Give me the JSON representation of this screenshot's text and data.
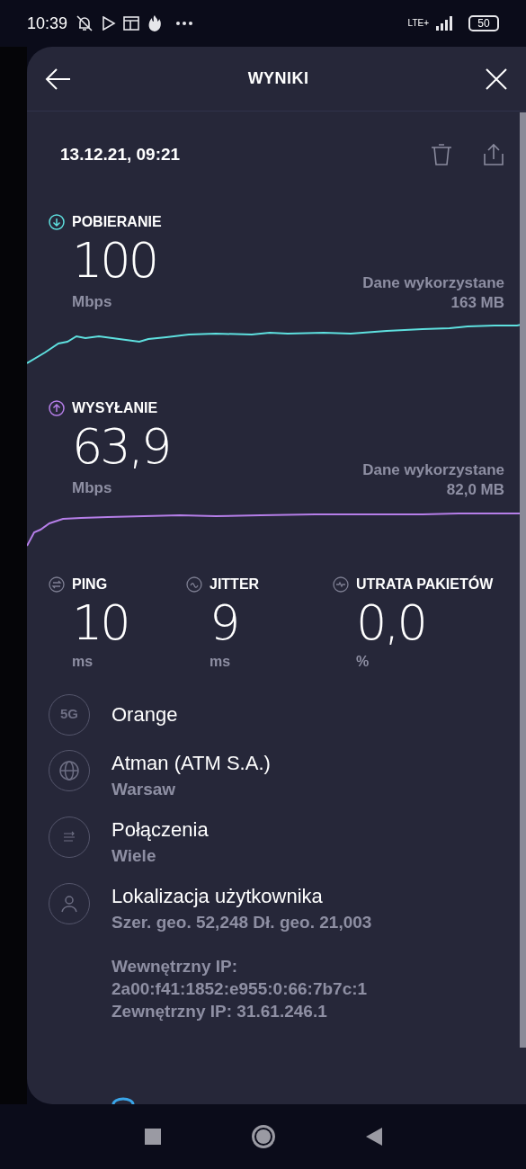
{
  "status_bar": {
    "time": "10:39",
    "network": "LTE+",
    "battery": "50"
  },
  "header": {
    "title": "WYNIKI"
  },
  "result": {
    "date": "13.12.21, 09:21"
  },
  "speeds": [
    {
      "kind": "download",
      "label": "POBIERANIE",
      "value": "100",
      "unit": "Mbps",
      "data_label": "Dane wykorzystane",
      "data_value": "163 MB",
      "color": "#5ee0df"
    },
    {
      "kind": "upload",
      "label": "WYSYŁANIE",
      "value": "63,9",
      "unit": "Mbps",
      "data_label": "Dane wykorzystane",
      "data_value": "82,0 MB",
      "color": "#b57ee8"
    }
  ],
  "metrics": [
    {
      "kind": "ping",
      "label": "PING",
      "value": "10",
      "unit": "ms"
    },
    {
      "kind": "jitter",
      "label": "JITTER",
      "value": "9",
      "unit": "ms"
    },
    {
      "kind": "loss",
      "label": "UTRATA PAKIETÓW",
      "value": "0,0",
      "unit": "%"
    }
  ],
  "info": [
    {
      "kind": "network",
      "icon_text": "5G",
      "title": "Orange"
    },
    {
      "kind": "server",
      "title": "Atman (ATM S.A.)",
      "subtitle": "Warsaw"
    },
    {
      "kind": "connections",
      "title": "Połączenia",
      "subtitle": "Wiele"
    },
    {
      "kind": "location",
      "title": "Lokalizacja użytkownika",
      "subtitle": "Szer. geo. 52,248 Dł. geo. 21,003",
      "details": [
        "Wewnętrzny IP:",
        "2a00:f41:1852:e955:0:66:7b7c:1",
        "Zewnętrzny IP: 31.61.246.1"
      ]
    }
  ]
}
